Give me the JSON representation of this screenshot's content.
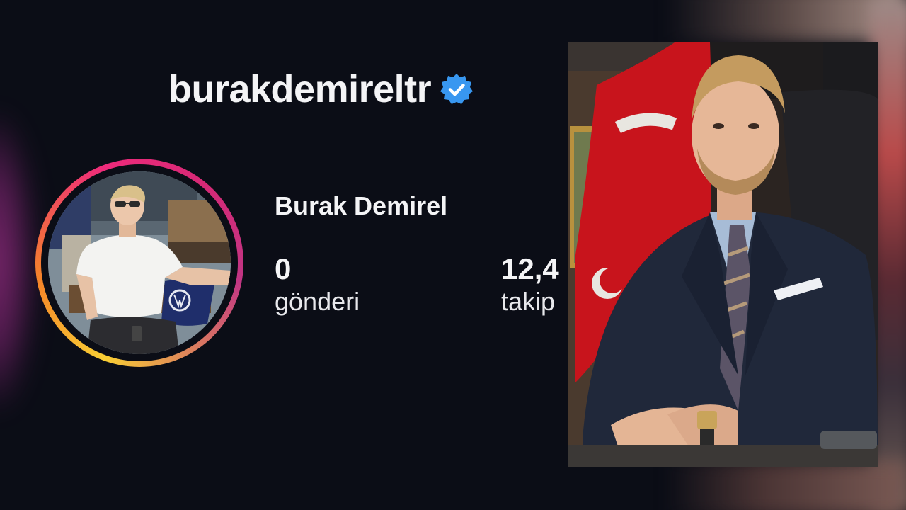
{
  "profile": {
    "username": "burakdemireltr",
    "full_name": "Burak Demirel",
    "verified_icon": "verified-badge-icon",
    "stats": {
      "posts_count": "0",
      "posts_label": "gönderi",
      "followers_count": "12,4",
      "followers_label": "takip"
    }
  },
  "colors": {
    "background": "#0b0d16",
    "text": "#f4f4f6",
    "verified_blue": "#3897f0",
    "story_ring": [
      "#f9ce34",
      "#f58529",
      "#ee2a7b",
      "#c13584"
    ]
  }
}
